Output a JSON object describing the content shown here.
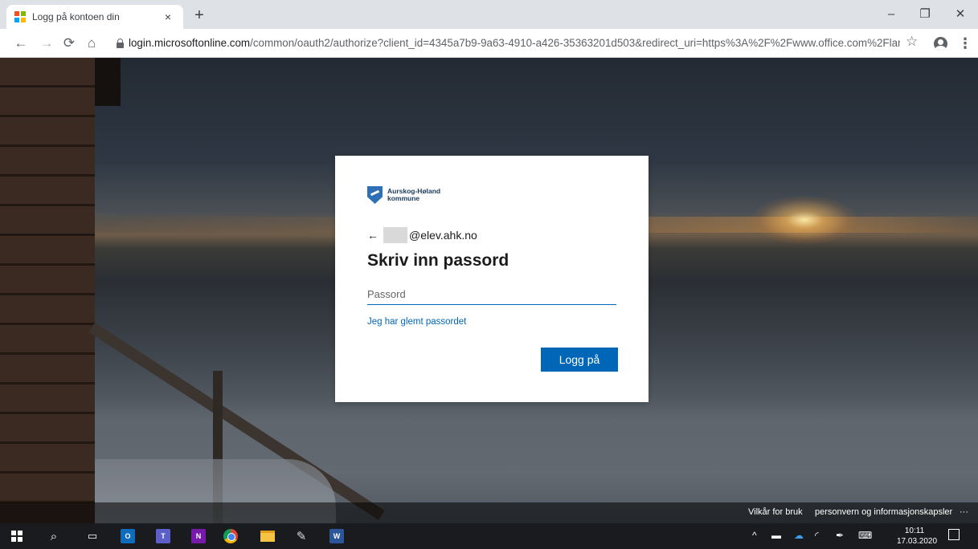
{
  "browser": {
    "tab_title": "Logg på kontoen din",
    "tab_close": "×",
    "new_tab": "+",
    "url_host": "login.microsoftonline.com",
    "url_rest": "/common/oauth2/authorize?client_id=4345a7b9-9a63-4910-a426-35363201d503&redirect_uri=https%3A%2F%2Fwww.office.com%2Flanding&res..."
  },
  "signin": {
    "org_name_line1": "Aurskog-Høland",
    "org_name_line2": "kommune",
    "back_arrow": "←",
    "account_suffix": "@elev.ahk.no",
    "heading": "Skriv inn passord",
    "password_placeholder": "Passord",
    "forgot_link": "Jeg har glemt passordet",
    "submit_label": "Logg på"
  },
  "footer": {
    "terms": "Vilkår for bruk",
    "privacy": "personvern og informasjonskapsler",
    "more": "···"
  },
  "taskbar": {
    "time": "10:11",
    "date": "17.03.2020"
  },
  "colors": {
    "accent": "#0067b8",
    "taskbar": "#1a1b1f",
    "chrome_tabbar": "#dee1e6"
  }
}
